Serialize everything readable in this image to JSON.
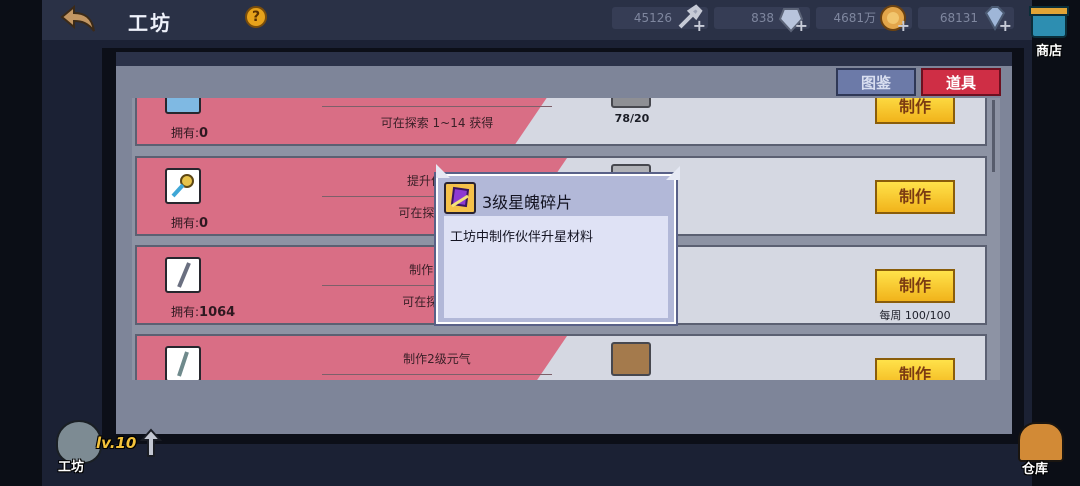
{
  "header": {
    "title": "工坊",
    "help_label": "?"
  },
  "resources": [
    {
      "value": "45126",
      "icon": "wrench-icon"
    },
    {
      "value": "838",
      "icon": "crystal-icon"
    },
    {
      "value": "4681万",
      "icon": "gold-coin-icon"
    },
    {
      "value": "68131",
      "icon": "diamond-icon"
    }
  ],
  "shop": {
    "label": "商店"
  },
  "tabs": [
    {
      "label": "图鉴"
    },
    {
      "label": "道具"
    }
  ],
  "recipes": [
    {
      "line1": "",
      "line2": "可在探索 1~14 获得",
      "owned_label": "拥有:",
      "owned": "0",
      "material_count": "78/20",
      "button": "制作",
      "weekly": ""
    },
    {
      "line1": "提升伙伴星",
      "line2": "可在探索 1~1",
      "owned_label": "拥有:",
      "owned": "0",
      "material_count": "",
      "button": "制作",
      "weekly": ""
    },
    {
      "line1": "制作1级元",
      "line2": "可在探索 1~",
      "owned_label": "拥有:",
      "owned": "1064",
      "material_count": "",
      "button": "制作",
      "weekly": "每周 100/100"
    },
    {
      "line1": "制作2级元气",
      "line2": "",
      "owned_label": "",
      "owned": "",
      "material_count": "",
      "button": "制作",
      "weekly": ""
    }
  ],
  "tooltip": {
    "title": "3级星魄碎片",
    "description": "工坊中制作伙伴升星材料"
  },
  "workshop": {
    "level": "lv.10",
    "label": "工坊"
  },
  "warehouse": {
    "label": "仓库"
  },
  "colors": {
    "accent_pink": "#d9546e",
    "button_yellow": "#f1b31b",
    "tab_red": "#cf2e45",
    "tab_blue": "#6c7aa8"
  }
}
